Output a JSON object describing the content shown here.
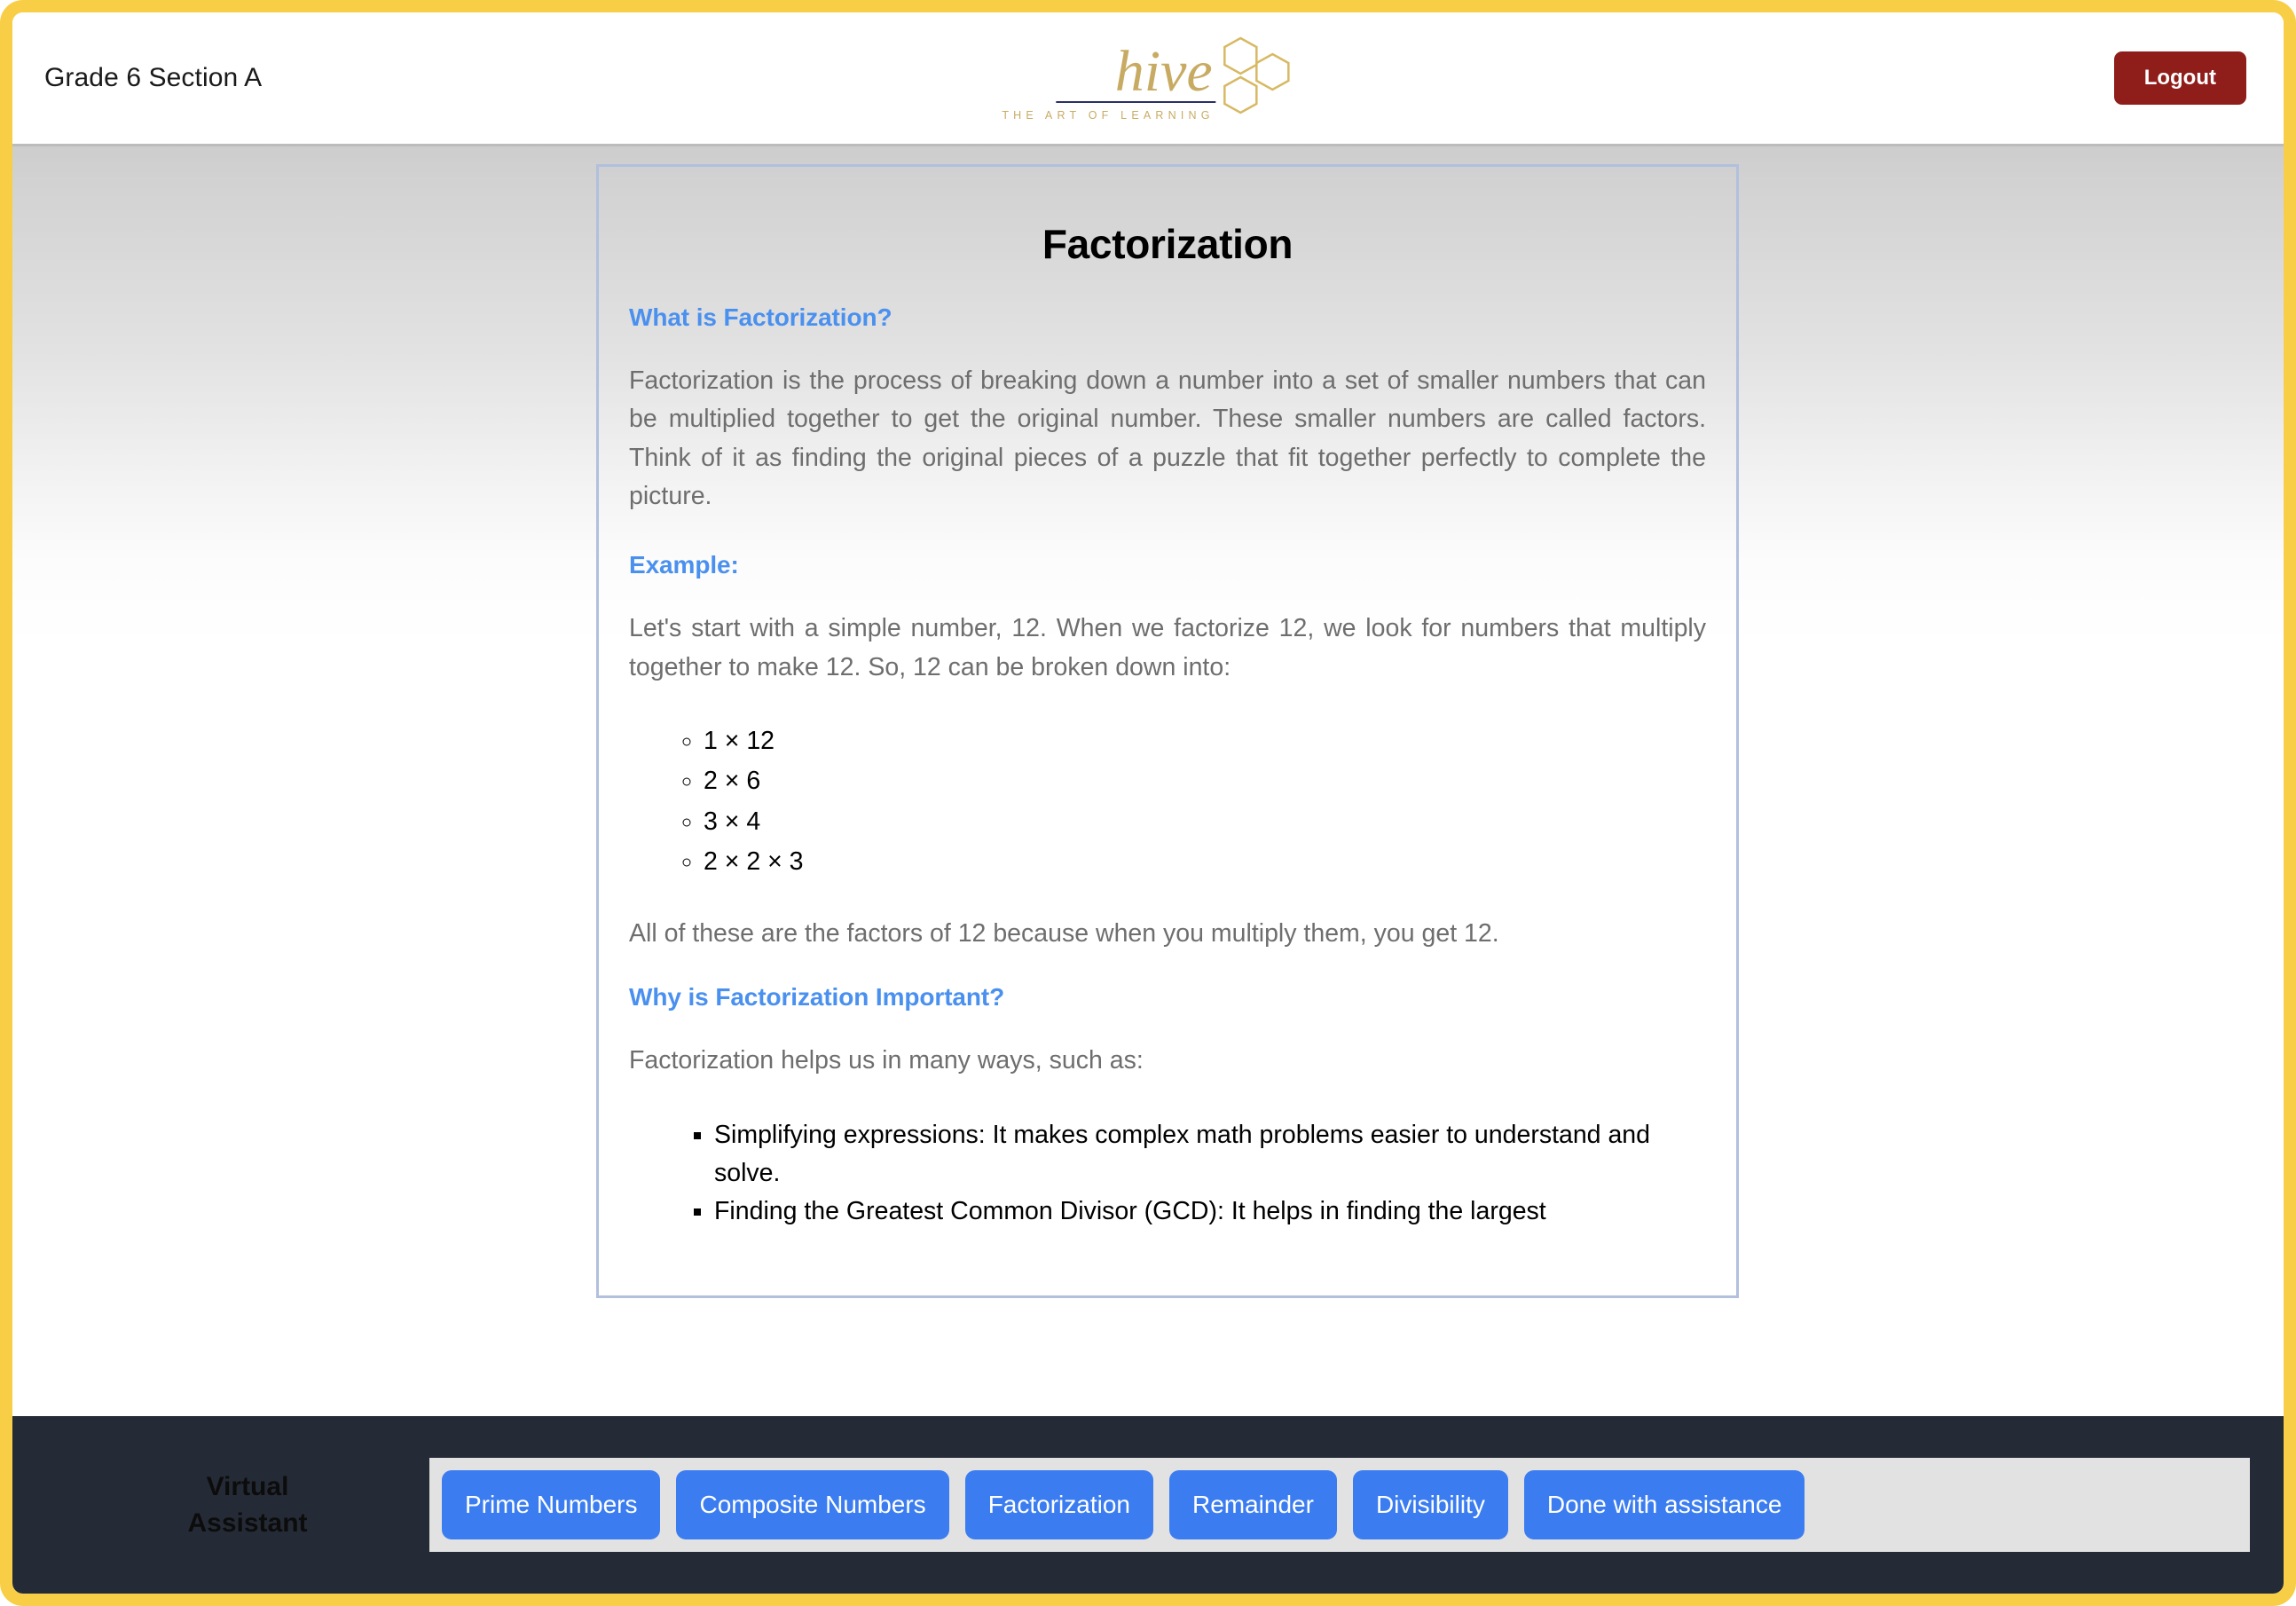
{
  "header": {
    "class_title": "Grade 6 Section A",
    "logo": {
      "wordmark": "hive",
      "tagline": "THE ART OF LEARNING",
      "gold": "#c8ab63",
      "rule_color": "#2a2f66"
    },
    "logout_label": "Logout",
    "logout_color": "#8f1d1a"
  },
  "theme": {
    "frame_yellow": "#f7ce46",
    "heading_blue": "#4a90ef",
    "body_gray": "#6e6e6e",
    "card_border": "#b2c0dd",
    "assistant_bar_bg": "#252b36",
    "chip_blue": "#3b7df0",
    "chip_tray_bg": "#e2e2e2"
  },
  "lesson": {
    "title": "Factorization",
    "sections": [
      {
        "heading": "What is Factorization?",
        "paragraph": "Factorization is the process of breaking down a number into a set of smaller numbers that can be multiplied together to get the original number. These smaller numbers are called factors. Think of it as finding the original pieces of a puzzle that fit together perfectly to complete the picture."
      },
      {
        "heading": "Example:",
        "paragraph": "Let's start with a simple number, 12. When we factorize 12, we look for numbers that multiply together to make 12. So, 12 can be broken down into:",
        "items": [
          "1 × 12",
          "2 × 6",
          "3 × 4",
          "2 × 2 × 3"
        ],
        "closing": "All of these are the factors of 12 because when you multiply them, you get 12."
      },
      {
        "heading": "Why is Factorization Important?",
        "paragraph": "Factorization helps us in many ways, such as:",
        "items": [
          "Simplifying expressions: It makes complex math problems easier to understand and solve.",
          "Finding the Greatest Common Divisor (GCD): It helps in finding the largest"
        ]
      }
    ]
  },
  "assistant": {
    "label_line1": "Virtual",
    "label_line2": "Assistant",
    "chips": [
      "Prime Numbers",
      "Composite Numbers",
      "Factorization",
      "Remainder",
      "Divisibility",
      "Done with assistance"
    ]
  }
}
